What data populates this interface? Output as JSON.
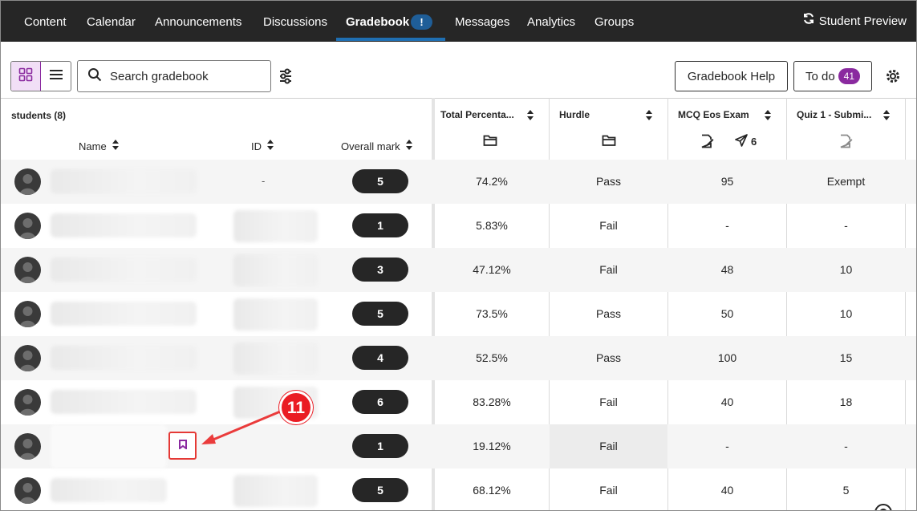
{
  "nav": {
    "tabs": [
      {
        "label": "Content"
      },
      {
        "label": "Calendar"
      },
      {
        "label": "Announcements"
      },
      {
        "label": "Discussions"
      },
      {
        "label": "Gradebook",
        "badge": "!"
      },
      {
        "label": "Messages"
      },
      {
        "label": "Analytics"
      },
      {
        "label": "Groups"
      }
    ],
    "active_tab": "Gradebook",
    "student_preview": "Student Preview"
  },
  "toolbar": {
    "search_placeholder": "Search gradebook",
    "help_button": "Gradebook Help",
    "todo_button": "To do",
    "todo_count": "41"
  },
  "grid": {
    "students_header": "students (8)",
    "subheaders": {
      "name": "Name",
      "id": "ID",
      "overall": "Overall mark"
    },
    "columns": [
      {
        "title": "Total Percenta...",
        "icon": "folder-icon"
      },
      {
        "title": "Hurdle",
        "icon": "folder-icon"
      },
      {
        "title": "MCQ Eos Exam",
        "icon": "edit-document-icon",
        "posted": "6"
      },
      {
        "title": "Quiz 1 - Submi...",
        "icon": "edit-document-icon"
      }
    ],
    "rows": [
      {
        "id": "-",
        "overall": "5",
        "total": "74.2%",
        "hurdle": "Pass",
        "mcq": "95",
        "quiz": "Exempt"
      },
      {
        "id": "",
        "overall": "1",
        "total": "5.83%",
        "hurdle": "Fail",
        "mcq": "-",
        "quiz": "-"
      },
      {
        "id": "",
        "overall": "3",
        "total": "47.12%",
        "hurdle": "Fail",
        "mcq": "48",
        "quiz": "10"
      },
      {
        "id": "",
        "overall": "5",
        "total": "73.5%",
        "hurdle": "Pass",
        "mcq": "50",
        "quiz": "10"
      },
      {
        "id": "",
        "overall": "4",
        "total": "52.5%",
        "hurdle": "Pass",
        "mcq": "100",
        "quiz": "15"
      },
      {
        "id": "",
        "overall": "6",
        "total": "83.28%",
        "hurdle": "Fail",
        "mcq": "40",
        "quiz": "18"
      },
      {
        "id": "",
        "overall": "1",
        "total": "19.12%",
        "hurdle": "Fail",
        "mcq": "-",
        "quiz": "-"
      },
      {
        "id": "",
        "overall": "5",
        "total": "68.12%",
        "hurdle": "Fail",
        "mcq": "40",
        "quiz": "5"
      }
    ]
  },
  "callout": {
    "number": "11"
  },
  "colors": {
    "nav_bg": "#262626",
    "accent_purple": "#8a2a9f",
    "active_underline": "#1f6fb2",
    "callout_red": "#ea1c24"
  }
}
